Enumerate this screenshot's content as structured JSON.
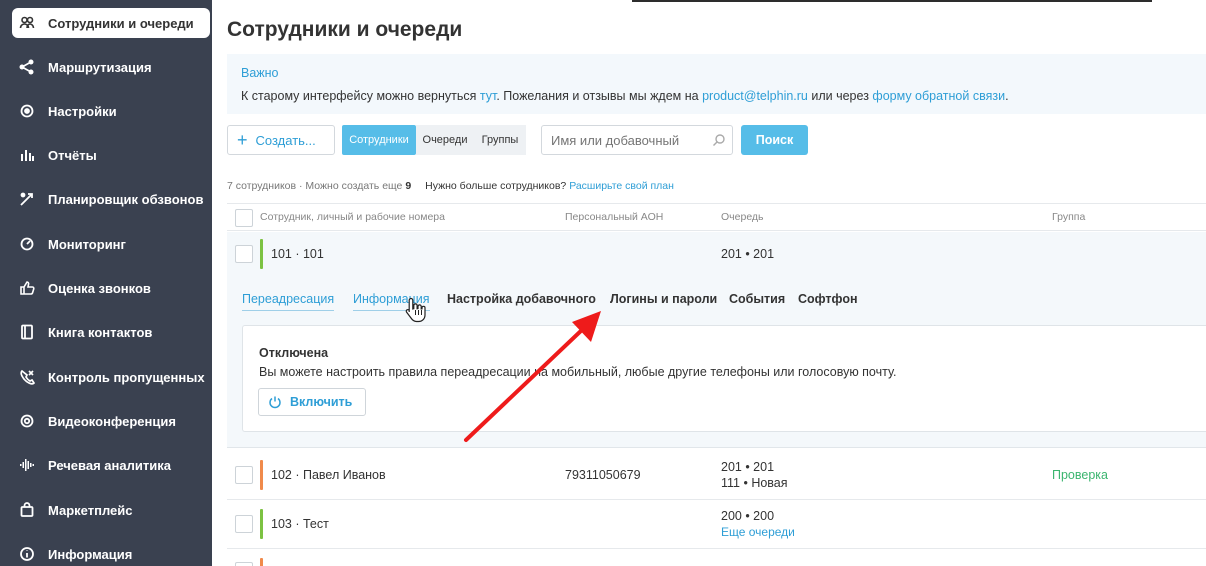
{
  "sidebar": {
    "items": [
      {
        "label": "Сотрудники и очереди",
        "icon": "people-icon",
        "active": true
      },
      {
        "label": "Маршрутизация",
        "icon": "routing-icon"
      },
      {
        "label": "Настройки",
        "icon": "settings-icon"
      },
      {
        "label": "Отчёты",
        "icon": "reports-icon"
      },
      {
        "label": "Планировщик обзвонов",
        "icon": "dialer-icon"
      },
      {
        "label": "Мониторинг",
        "icon": "monitoring-icon"
      },
      {
        "label": "Оценка звонков",
        "icon": "thumbs-up-icon"
      },
      {
        "label": "Книга контактов",
        "icon": "contacts-book-icon"
      },
      {
        "label": "Контроль пропущенных",
        "icon": "missed-calls-icon"
      },
      {
        "label": "Видеоконференция",
        "icon": "video-conference-icon"
      },
      {
        "label": "Речевая аналитика",
        "icon": "speech-analytics-icon"
      },
      {
        "label": "Маркетплейс",
        "icon": "marketplace-icon"
      },
      {
        "label": "Информация",
        "icon": "info-icon"
      }
    ]
  },
  "page": {
    "title": "Сотрудники и очереди"
  },
  "notice": {
    "title": "Важно",
    "text_1": "К старому интерфейсу можно вернуться ",
    "link_1": "тут",
    "text_2": ". Пожелания и отзывы мы ждем на ",
    "link_2": "product@telphin.ru",
    "text_3": " или через ",
    "link_3": "форму обратной связи",
    "text_4": "."
  },
  "toolbar": {
    "create_label": "Создать...",
    "segments": [
      "Сотрудники",
      "Очереди",
      "Группы"
    ],
    "search_placeholder": "Имя или добавочный",
    "search_button": "Поиск"
  },
  "summary": {
    "count_text": "7 сотрудников · Можно создать еще ",
    "count_value": "9",
    "more_text": "Нужно больше сотрудников?",
    "more_link": "Расширьте свой план"
  },
  "table": {
    "headers": [
      "Сотрудник, личный и рабочие номера",
      "Персональный АОН",
      "Очередь",
      "Группа"
    ],
    "rows": [
      {
        "employee": "101 · 101",
        "aon": "",
        "queue": "201 • 201",
        "queue2": "",
        "group": "",
        "status_color": "#7cc242"
      },
      {
        "employee": "102 · Павел Иванов",
        "aon": "79311050679",
        "queue": "201 • 201",
        "queue2": "111 • Новая",
        "group": "Проверка",
        "status_color": "#f08a4b"
      },
      {
        "employee": "103 · Тест",
        "aon": "",
        "queue": "200 • 200",
        "queue2": "Еще очереди",
        "group": "",
        "status_color": "#7cc242"
      }
    ]
  },
  "details": {
    "tabs": [
      "Переадресация",
      "Информация",
      "Настройка добавочного",
      "Логины и пароли",
      "События",
      "Софтфон"
    ],
    "forwarding": {
      "status": "Отключена",
      "description": "Вы можете настроить правила переадресации на мобильный, любые другие телефоны или голосовую почту.",
      "enable_button": "Включить"
    }
  },
  "colors": {
    "accent": "#2e9ed6",
    "sidebar_bg": "#3a4150",
    "annotation_arrow": "#ee1b1b"
  }
}
